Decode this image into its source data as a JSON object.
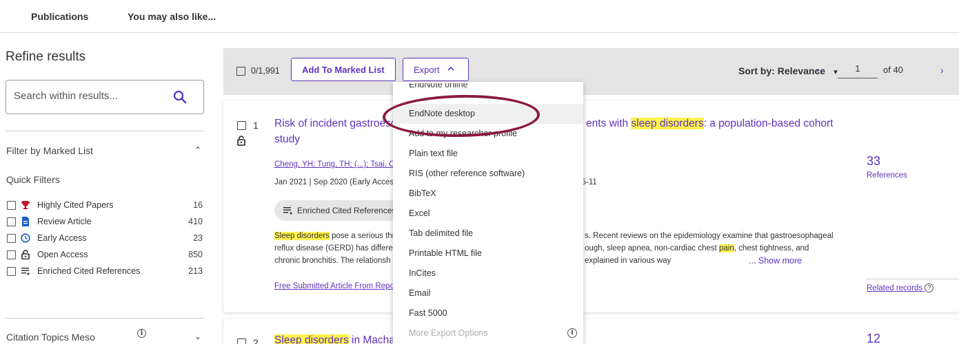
{
  "topnav": {
    "tabs": [
      "Publications",
      "You may also like..."
    ]
  },
  "sidebar": {
    "title": "Refine results",
    "search_placeholder": "Search within results...",
    "filter_marked_list": "Filter by Marked List",
    "quick_filters_title": "Quick Filters",
    "quick_filters": [
      {
        "icon": "trophy-icon",
        "label": "Highly Cited Papers",
        "count": "16"
      },
      {
        "icon": "document-icon",
        "label": "Review Article",
        "count": "410"
      },
      {
        "icon": "clock-icon",
        "label": "Early Access",
        "count": "23"
      },
      {
        "icon": "unlock-icon",
        "label": "Open Access",
        "count": "850"
      },
      {
        "icon": "enriched-list-icon",
        "label": "Enriched Cited References",
        "count": "213"
      }
    ],
    "citation_topics": "Citation Topics Meso"
  },
  "toolbar": {
    "selected_count": "0/1,991",
    "add_to_marked": "Add To Marked List",
    "export_label": "Export",
    "sort_label": "Sort by: Relevance",
    "page": "1",
    "of_pages": "of 40"
  },
  "export_menu": {
    "items": [
      "EndNote online",
      "EndNote desktop",
      "Add to my researcher profile",
      "Plain text file",
      "RIS (other reference software)",
      "BibTeX",
      "Excel",
      "Tab delimited file",
      "Printable HTML file",
      "InCites",
      "Email",
      "Fast 5000",
      "More Export Options"
    ],
    "highlighted": "EndNote desktop"
  },
  "record1": {
    "number": "1",
    "title_part1": "Risk of incident gastroeso",
    "title_part2": "ents with ",
    "title_hl": "sleep disorders",
    "title_part3": ": a population-based cohort",
    "title_line2": "study",
    "authors": "Cheng, YH; Tung, TH; (...); Tsai, CY",
    "meta_left": "Jan 2021 | Sep 2020 (Early Access)",
    "meta_right": "p.5-11",
    "enriched_label": "Enriched Cited References",
    "abs_hl1": "Sleep disorders",
    "abs_l1_a": " pose a serious thr",
    "abs_l1_b": "s. Recent reviews on the epidemiology examine that gastroesophageal",
    "abs_l2_a": "reflux disease (GERD) has differen",
    "abs_l2_b": "ough, sleep apnea, non-cardiac chest ",
    "abs_hl2": "pain",
    "abs_l2_c": ", chest tightness, and",
    "abs_l3_a": "chronic bronchitis. The relationsh",
    "abs_l3_b": "explained in various way",
    "show_more": "... Show more",
    "fulltext": "Free Submitted Article From Repo",
    "citations": "33",
    "citations_label": "References",
    "related": "Related records"
  },
  "record2": {
    "number": "2",
    "title_hl": "Sleep disorders",
    "title_rest": " in Machad",
    "citations": "12"
  },
  "colors": {
    "accent": "#5e33bf",
    "highlight": "#fff34d",
    "annotation": "#8b1a3c"
  }
}
